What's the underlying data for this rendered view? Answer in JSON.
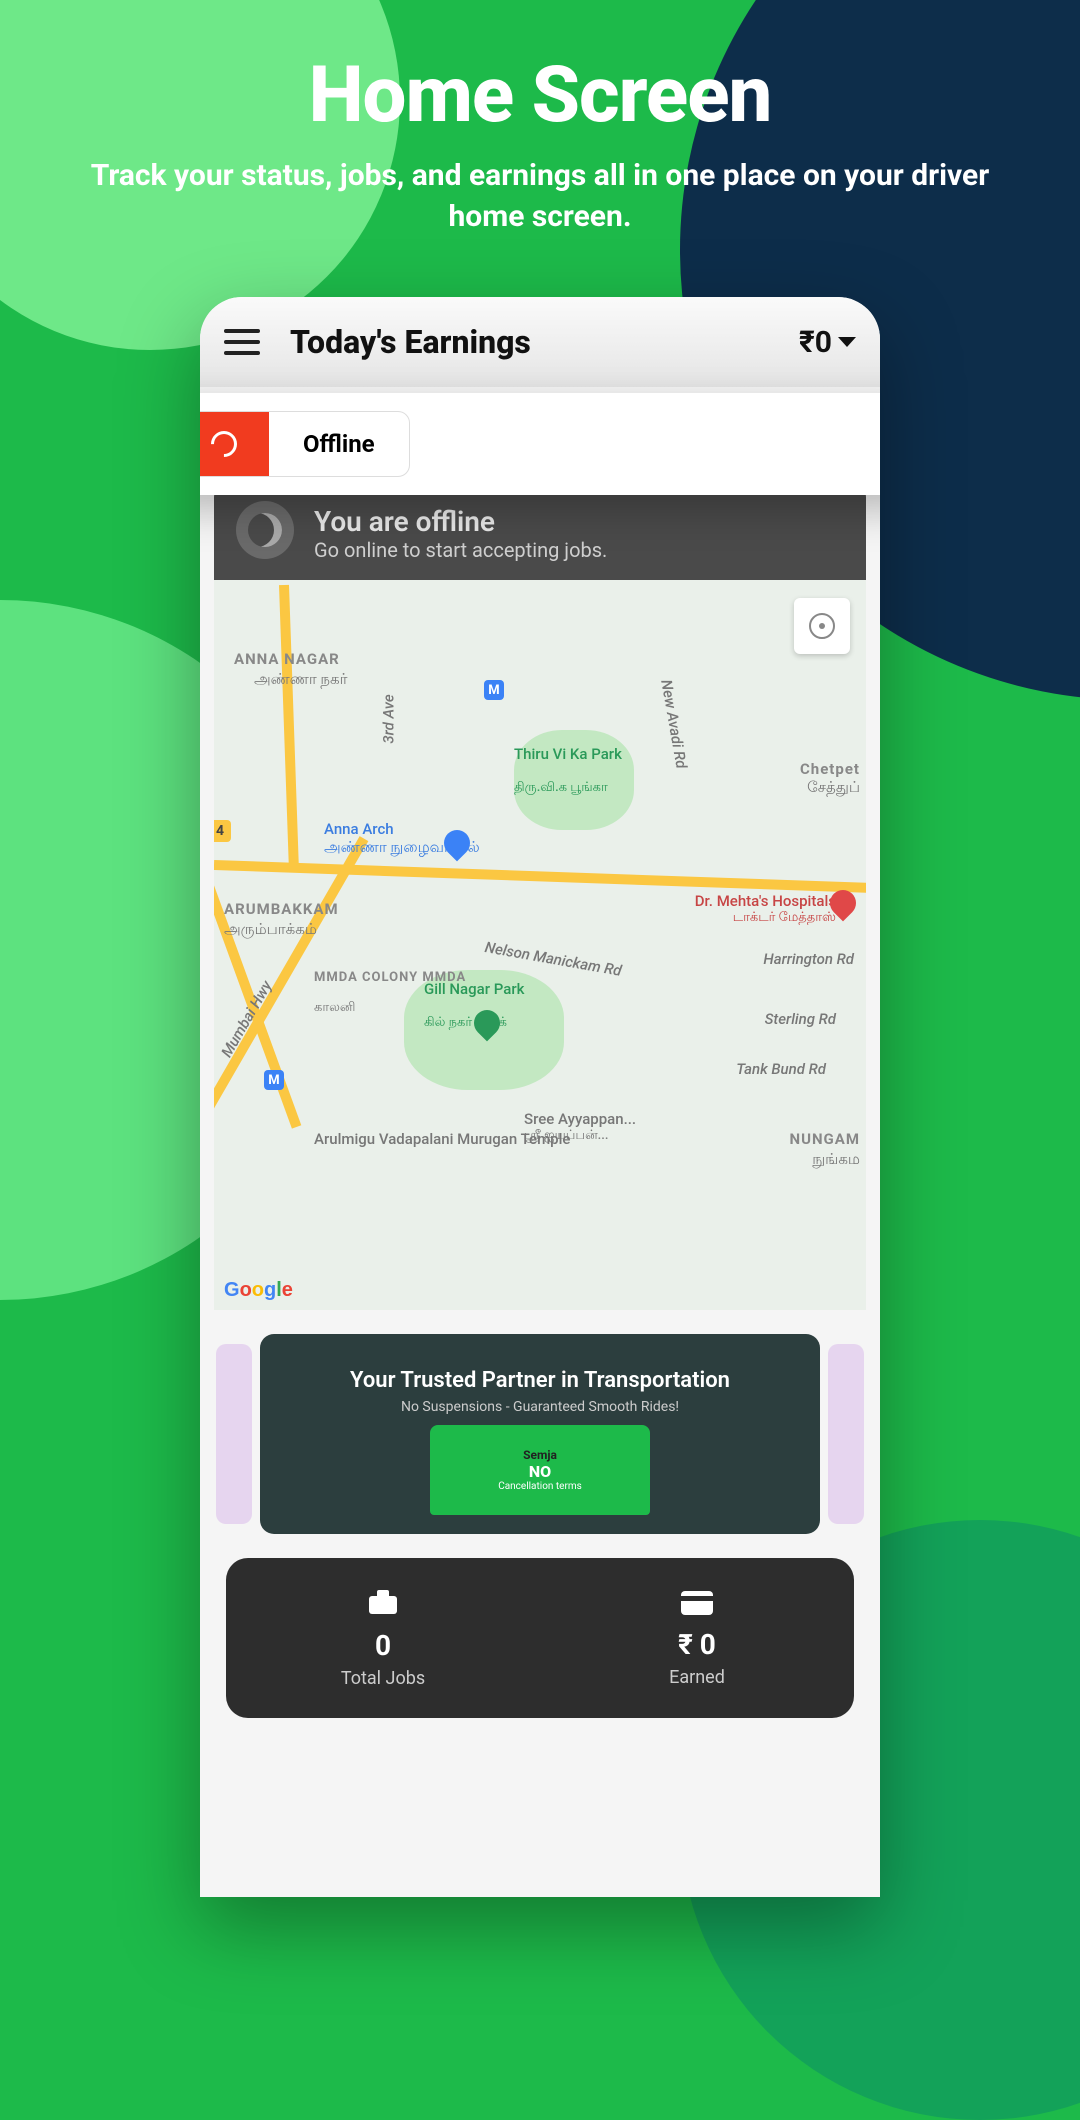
{
  "promo": {
    "title": "Home Screen",
    "subtitle": "Track your status, jobs, and earnings all in one place on your driver home screen."
  },
  "topbar": {
    "title": "Today's Earnings",
    "amount": "₹0"
  },
  "status": {
    "toggle_label": "Offline"
  },
  "banner": {
    "title": "You are offline",
    "subtitle": "Go online to start accepting jobs."
  },
  "map": {
    "places": {
      "anna_nagar": "ANNA NAGAR",
      "anna_nagar_ta": "அண்ணா நகர்",
      "anna_arch": "Anna Arch",
      "anna_arch_ta": "அண்ணா நுழைவாயில்",
      "arumbakkam": "ARUMBAKKAM",
      "arumbakkam_ta": "அரும்பாக்கம்",
      "mmda": "MMDA COLONY MMDA",
      "mmda_ta": "காலனி",
      "gill_nagar": "Gill Nagar Park",
      "gill_nagar_ta": "கில் நகர் பார்க்",
      "thiru_vi": "Thiru Vi Ka Park",
      "thiru_vi_ta": "திரு.வி.க பூங்கா",
      "chetpet": "Chetpet",
      "chetpet_ta": "சேத்துப்",
      "mehta": "Dr. Mehta's Hospitals",
      "mehta_ta": "டாக்டர் மேத்தாஸ்",
      "harrington": "Harrington Rd",
      "sterling": "Sterling Rd",
      "tank": "Tank Bund Rd",
      "nelson": "Nelson Manickam Rd",
      "new_avadi": "New Avadi Rd",
      "third_ave": "3rd Ave",
      "mumbai": "Mumbai Hwy",
      "sree": "Sree Ayyappan...",
      "sree_ta": "ஸ்ரீ ஐயப்பன்...",
      "murugan": "Arulmigu Vadapalani Murugan Temple",
      "nungam": "NUNGAM",
      "nungam_ta": "நுங்கம"
    },
    "attribution": "Google",
    "road_label_4": "4"
  },
  "ad": {
    "title": "Your Trusted Partner in Transportation",
    "subtitle": "No Suspensions - Guaranteed Smooth Rides!",
    "truck_brand": "Semja",
    "truck_no": "NO",
    "truck_cancel": "Cancellation terms"
  },
  "stats": {
    "jobs": {
      "value": "0",
      "label": "Total Jobs"
    },
    "earned": {
      "value": "₹ 0",
      "label": "Earned"
    }
  }
}
